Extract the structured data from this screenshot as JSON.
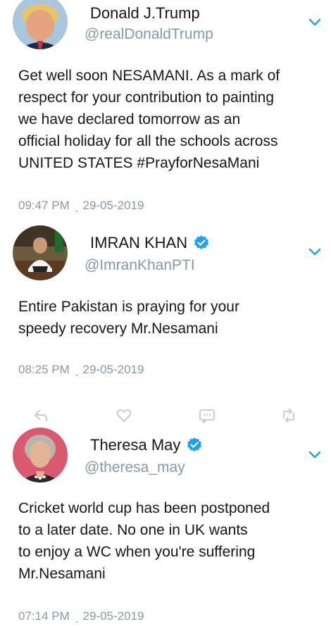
{
  "tweets": [
    {
      "name": "Donald J.Trump",
      "handle": "@realDonaldTrump",
      "verified": false,
      "text": "Get well soon NESAMANI. As a mark of\nrespect for your contribution to painting\nwe have declared tomorrow as an\nofficial holiday for all the schools across\nUNITED STATES #PrayforNesaMani",
      "time": "09:47 PM",
      "separator": ".",
      "date": "29-05-2019"
    },
    {
      "name": "IMRAN KHAN",
      "handle": "@ImranKhanPTI",
      "verified": true,
      "text": "Entire Pakistan is praying for your\nspeedy recovery Mr.Nesamani",
      "time": "08:25 PM",
      "separator": ".",
      "date": "29-05-2019"
    },
    {
      "name": "Theresa May",
      "handle": "@theresa_may",
      "verified": true,
      "text": "Cricket world cup has been postponed\nto a later date. No one in UK wants\nto enjoy a WC when you're suffering\nMr.Nesamani",
      "time": "07:14 PM",
      "separator": ".",
      "date": "29-05-2019"
    }
  ],
  "action_icons": [
    "reply-icon",
    "like-icon",
    "direct-message-icon",
    "retweet-icon"
  ],
  "colors": {
    "text": "#14171a",
    "muted": "#8899a6",
    "verified": "#1da1f2",
    "chevron": "#1da1f2"
  }
}
